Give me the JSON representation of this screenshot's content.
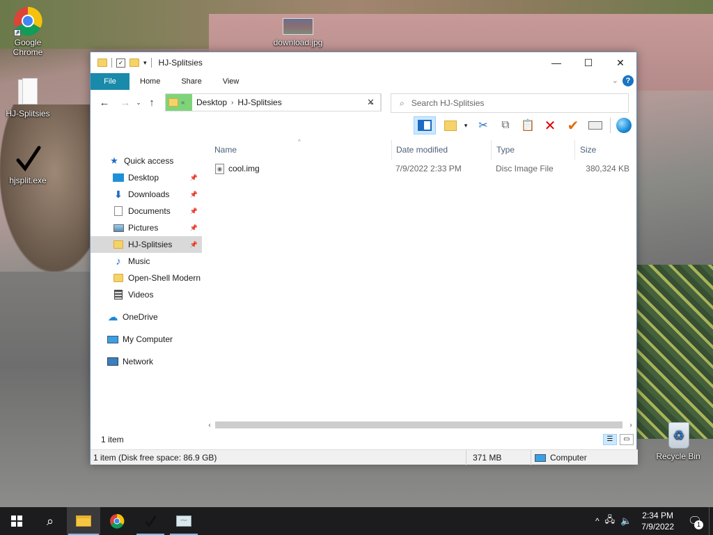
{
  "desktop": {
    "icons": [
      {
        "label": "Google Chrome",
        "icon": "chrome-icon"
      },
      {
        "label": "download.jpg",
        "icon": "image-thumbnail-icon"
      },
      {
        "label": "HJ-Splitsies",
        "icon": "folder-icon"
      },
      {
        "label": "hjsplit.exe",
        "icon": "checkmark-icon"
      },
      {
        "label": "Recycle Bin",
        "icon": "recycle-bin-icon"
      }
    ]
  },
  "window": {
    "title": "HJ-Splitsies",
    "ribbon_tabs": [
      "File",
      "Home",
      "Share",
      "View"
    ],
    "help_label": "?",
    "address": {
      "overflow": "«",
      "crumbs": [
        "Desktop",
        "HJ-Splitsies"
      ]
    },
    "search": {
      "placeholder": "Search HJ-Splitsies"
    },
    "nav_pane": {
      "quick_access": "Quick access",
      "items": [
        {
          "label": "Desktop",
          "icon": "desktop-icon",
          "pinned": true
        },
        {
          "label": "Downloads",
          "icon": "download-arrow-icon",
          "pinned": true
        },
        {
          "label": "Documents",
          "icon": "documents-icon",
          "pinned": true
        },
        {
          "label": "Pictures",
          "icon": "pictures-icon",
          "pinned": true
        },
        {
          "label": "HJ-Splitsies",
          "icon": "folder-icon",
          "pinned": true,
          "selected": true
        },
        {
          "label": "Music",
          "icon": "music-icon",
          "pinned": false
        },
        {
          "label": "Open-Shell Modern",
          "icon": "folder-icon",
          "pinned": false
        },
        {
          "label": "Videos",
          "icon": "videos-icon",
          "pinned": false
        }
      ],
      "onedrive": "OneDrive",
      "my_computer": "My Computer",
      "network": "Network"
    },
    "columns": {
      "name": "Name",
      "date": "Date modified",
      "type": "Type",
      "size": "Size"
    },
    "files": [
      {
        "name": "cool.img",
        "date": "7/9/2022 2:33 PM",
        "type": "Disc Image File",
        "size": "380,324 KB"
      }
    ],
    "item_count": "1 item",
    "statusbar": {
      "left": "1 item (Disk free space: 86.9 GB)",
      "size": "371 MB",
      "location": "Computer"
    }
  },
  "taskbar": {
    "clock_time": "2:34 PM",
    "clock_date": "7/9/2022",
    "notification_count": "1"
  },
  "colors": {
    "file_tab": "#1a8aaa",
    "address_highlight": "#7fd47a",
    "taskbar": "#1c1c1e",
    "accent": "#76b9ed"
  }
}
